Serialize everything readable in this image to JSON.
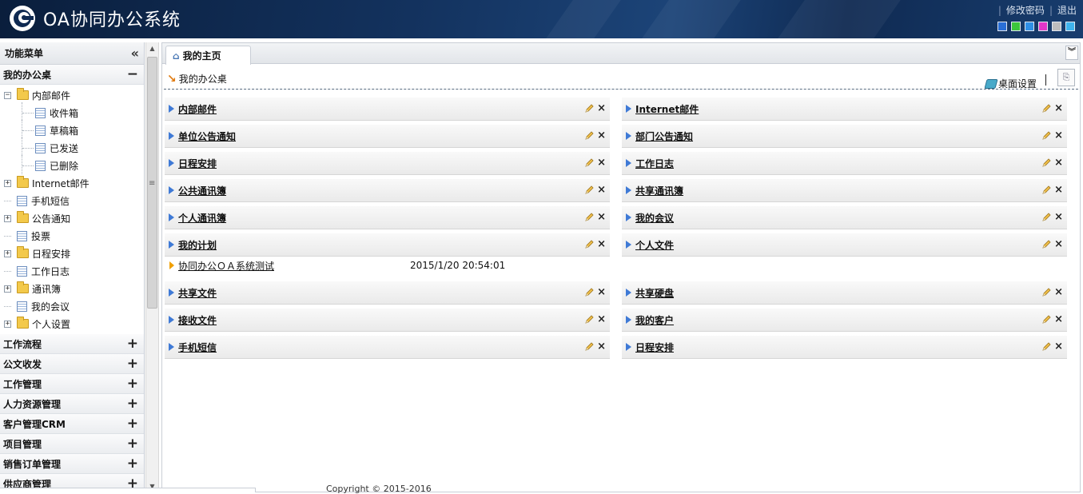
{
  "header": {
    "app_title": "OA协同办公系统",
    "change_password": "修改密码",
    "logout": "退出",
    "skin_colors": [
      "#2a6fd6",
      "#3cc63c",
      "#2f8fe6",
      "#e236c8",
      "#bdbdbd",
      "#3fb3ee"
    ]
  },
  "sidebar": {
    "title": "功能菜单",
    "collapse_icon": "«",
    "my_desk": {
      "label": "我的办公桌",
      "toggle": "−",
      "tree": [
        {
          "label": "内部邮件",
          "type": "folder",
          "expander": "−",
          "children": [
            "收件箱",
            "草稿箱",
            "已发送",
            "已删除"
          ]
        },
        {
          "label": "Internet邮件",
          "type": "folder",
          "expander": "+"
        },
        {
          "label": "手机短信",
          "type": "doc"
        },
        {
          "label": "公告通知",
          "type": "folder",
          "expander": "+"
        },
        {
          "label": "投票",
          "type": "doc"
        },
        {
          "label": "日程安排",
          "type": "folder",
          "expander": "+"
        },
        {
          "label": "工作日志",
          "type": "doc"
        },
        {
          "label": "通讯簿",
          "type": "folder",
          "expander": "+"
        },
        {
          "label": "我的会议",
          "type": "doc"
        },
        {
          "label": "个人设置",
          "type": "folder",
          "expander": "+"
        }
      ]
    },
    "sections": [
      {
        "label": "工作流程",
        "toggle": "+"
      },
      {
        "label": "公文收发",
        "toggle": "+"
      },
      {
        "label": "工作管理",
        "toggle": "+"
      },
      {
        "label": "人力资源管理",
        "toggle": "+"
      },
      {
        "label": "客户管理CRM",
        "toggle": "+"
      },
      {
        "label": "项目管理",
        "toggle": "+"
      },
      {
        "label": "销售订单管理",
        "toggle": "+"
      },
      {
        "label": "供应商管理",
        "toggle": "+"
      }
    ]
  },
  "main": {
    "tab_label": "我的主页",
    "desk_title": "我的办公桌",
    "desk_settings": "桌面设置",
    "left_panels": [
      "内部邮件",
      "单位公告通知",
      "日程安排",
      "公共通讯簿",
      "个人通讯簿",
      "我的计划",
      "共享文件",
      "接收文件",
      "手机短信"
    ],
    "right_panels": [
      "Internet邮件",
      "部门公告通知",
      "工作日志",
      "共享通讯簿",
      "我的会议",
      "个人文件",
      "共享硬盘",
      "我的客户",
      "日程安排"
    ],
    "plan_item": {
      "title": "协同办公ＯＡ系统测试",
      "date": "2015/1/20 20:54:01"
    },
    "close_glyph": "×",
    "copyright": "Copyright © 2015-2016"
  }
}
